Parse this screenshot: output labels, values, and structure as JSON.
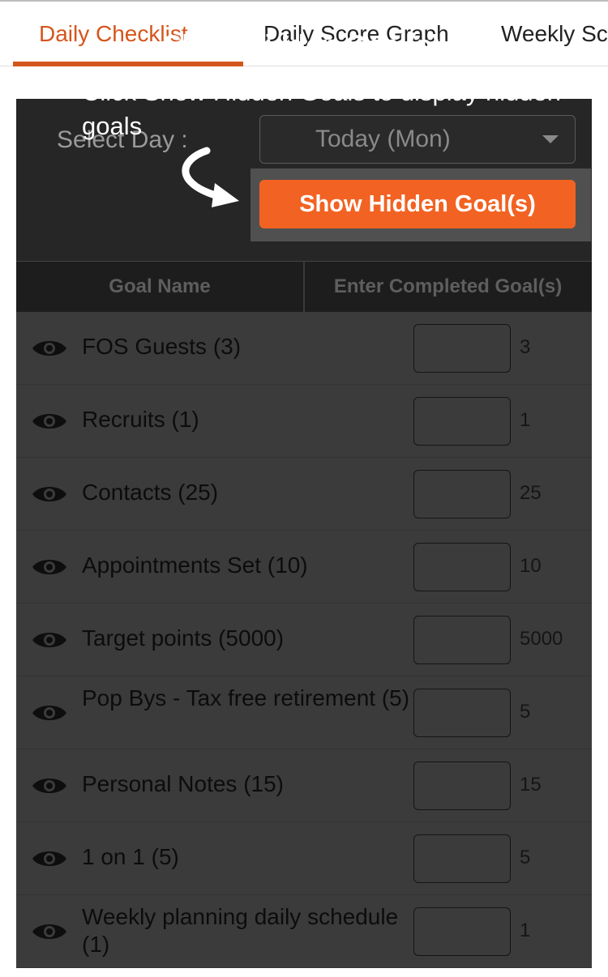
{
  "tabs": [
    {
      "label": "Daily Checklist"
    },
    {
      "label": "Daily Score Graph"
    },
    {
      "label": "Weekly Sc"
    }
  ],
  "day_selector": {
    "label": "Select Day :",
    "value": "Today (Mon)"
  },
  "table": {
    "headers": [
      "Goal Name",
      "Enter Completed Goal(s)"
    ],
    "rows": [
      {
        "name": "FOS Guests (3)",
        "target": "3"
      },
      {
        "name": "Recruits (1)",
        "target": "1"
      },
      {
        "name": "Contacts (25)",
        "target": "25"
      },
      {
        "name": "Appointments Set (10)",
        "target": "10"
      },
      {
        "name": "Target points (5000)",
        "target": "5000"
      },
      {
        "name": "Pop Bys - Tax free retirement (5)",
        "target": "5"
      },
      {
        "name": "Personal Notes (15)",
        "target": "15"
      },
      {
        "name": "1 on 1 (5)",
        "target": "5"
      },
      {
        "name": "Weekly planning daily schedule (1)",
        "target": "1"
      }
    ]
  },
  "tooltip": {
    "title": "Show Hidden Goal(s)",
    "body": "Click Show Hidden Goals to display hidden goals",
    "button_label": "Show Hidden Goal(s)"
  },
  "colors": {
    "accent": "#f26222",
    "active_tab": "#d4561c"
  },
  "icons": {
    "row_icon": "eye-icon",
    "dropdown": "chevron-down-icon",
    "pointer": "curved-arrow-icon"
  }
}
